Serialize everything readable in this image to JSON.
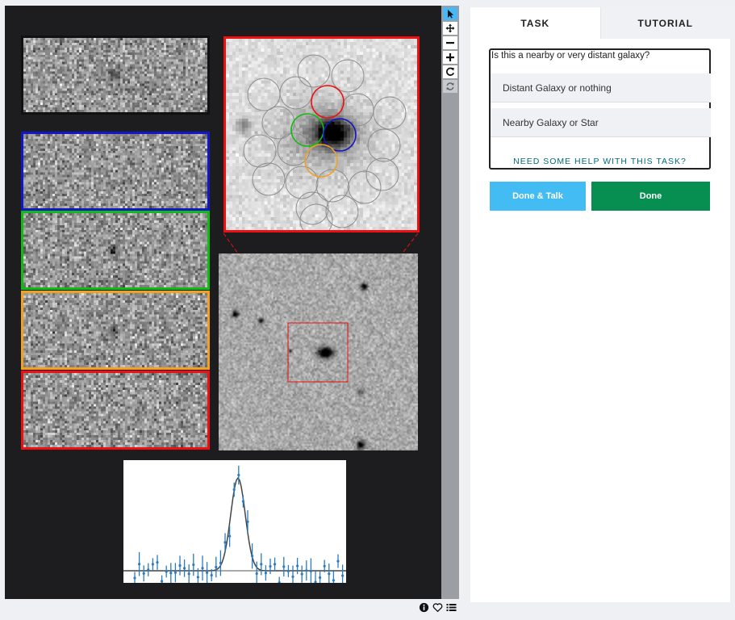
{
  "tabs": {
    "task": "TASK",
    "tutorial": "TUTORIAL"
  },
  "question": "Is this a nearby or very distant galaxy?",
  "answers": [
    {
      "label": "Distant Galaxy or nothing"
    },
    {
      "label": "Nearby Galaxy or Star"
    }
  ],
  "help_link": "NEED SOME HELP WITH THIS TASK?",
  "buttons": {
    "done_talk": "Done & Talk",
    "done": "Done"
  },
  "toolbar": {
    "tools": [
      "pointer-icon",
      "move-icon",
      "zoom-out-icon",
      "zoom-in-icon",
      "rotate-icon",
      "reset-icon"
    ],
    "active_tool": "pointer-icon"
  },
  "footer_icons": [
    "info-icon",
    "heart-icon",
    "list-icon"
  ],
  "colors": {
    "viewer_bg": "#1d1d20",
    "panel_red": "#ee1010",
    "panel_blue": "#1316c6",
    "panel_green": "#11bb11",
    "panel_orange": "#f0a022",
    "spectrum_points": "#2a7bbf",
    "done_talk": "#43bbf3",
    "done": "#078f52"
  },
  "cutouts": [
    {
      "name": "cutout-top",
      "frame": "none"
    },
    {
      "name": "cutout-blue",
      "frame": "blue"
    },
    {
      "name": "cutout-green",
      "frame": "green"
    },
    {
      "name": "cutout-orange",
      "frame": "orange"
    },
    {
      "name": "cutout-red",
      "frame": "red"
    }
  ],
  "apertures": {
    "highlighted": [
      "red",
      "green",
      "blue",
      "orange"
    ],
    "grey_count": 18
  }
}
